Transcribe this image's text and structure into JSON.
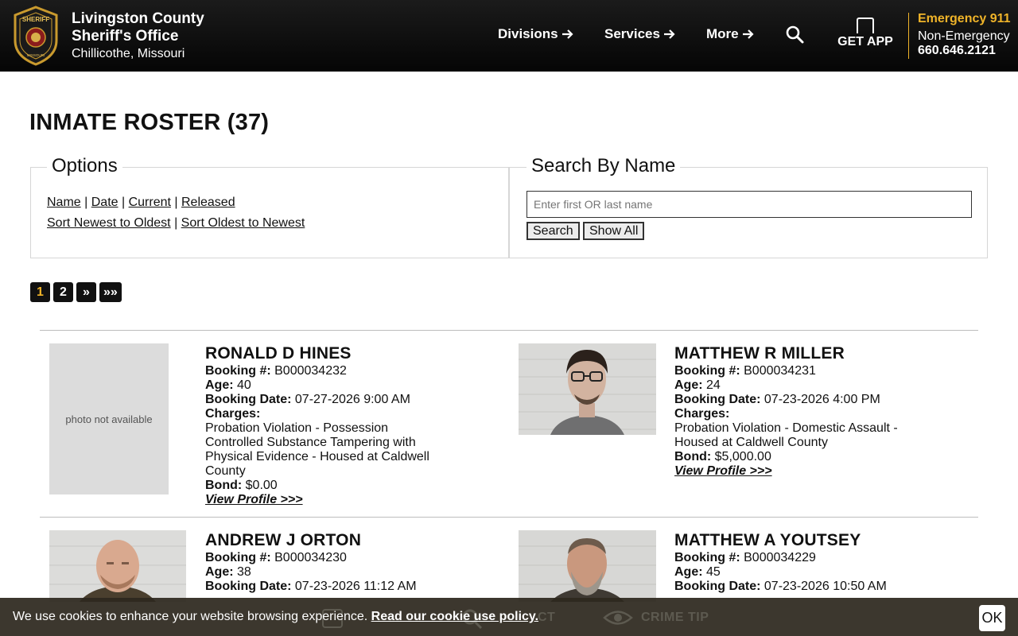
{
  "header": {
    "org_line1": "Livingston County",
    "org_line2": "Sheriff's Office",
    "location": "Chillicothe, Missouri",
    "badge_top": "SHERIFF",
    "badge_bottom": "MISSOURI",
    "nav": [
      {
        "label": "Divisions"
      },
      {
        "label": "Services"
      },
      {
        "label": "More"
      }
    ],
    "get_app": "GET APP",
    "emergency": "Emergency 911",
    "non_emergency_label": "Non-Emergency",
    "non_emergency_phone": "660.646.2121",
    "accent": "#f0b429"
  },
  "page": {
    "title": "INMATE ROSTER (37)"
  },
  "options": {
    "legend": "Options",
    "links_row1": [
      "Name",
      "Date",
      "Current",
      "Released"
    ],
    "links_row2": [
      "Sort Newest to Oldest",
      "Sort Oldest to Newest"
    ]
  },
  "search": {
    "legend": "Search By Name",
    "placeholder": "Enter first OR last name",
    "value": "",
    "search_button": "Search",
    "show_all_button": "Show All"
  },
  "pagination": [
    "1",
    "2",
    "»",
    "»»"
  ],
  "inmates": [
    {
      "name": "RONALD D HINES",
      "booking_label": "Booking #:",
      "booking": "B000034232",
      "age_label": "Age:",
      "age": "40",
      "date_label": "Booking Date:",
      "date": "07-27-2026 9:00 AM",
      "charges_label": "Charges:",
      "charges": "Probation Violation - Possession Controlled Substance Tampering with Physical Evidence - Housed at Caldwell County",
      "bond_label": "Bond:",
      "bond": "$0.00",
      "view": "View Profile >>>",
      "photo_text": "photo not available"
    },
    {
      "name": "MATTHEW R MILLER",
      "booking_label": "Booking #:",
      "booking": "B000034231",
      "age_label": "Age:",
      "age": "24",
      "date_label": "Booking Date:",
      "date": "07-23-2026 4:00 PM",
      "charges_label": "Charges:",
      "charges": "Probation Violation - Domestic Assault - Housed at Caldwell County",
      "bond_label": "Bond:",
      "bond": "$5,000.00",
      "view": "View Profile >>>"
    },
    {
      "name": "ANDREW J ORTON",
      "booking_label": "Booking #:",
      "booking": "B000034230",
      "age_label": "Age:",
      "age": "38",
      "date_label": "Booking Date:",
      "date": "07-23-2026 11:12 AM"
    },
    {
      "name": "MATTHEW A YOUTSEY",
      "booking_label": "Booking #:",
      "booking": "B000034229",
      "age_label": "Age:",
      "age": "45",
      "date_label": "Booking Date:",
      "date": "07-23-2026 10:50 AM"
    }
  ],
  "cookie": {
    "message": "We use cookies to enhance your website browsing experience.",
    "link": "Read our cookie use policy.",
    "ok": "OK",
    "behind_left": "CT",
    "behind_right": "CRIME TIP"
  }
}
